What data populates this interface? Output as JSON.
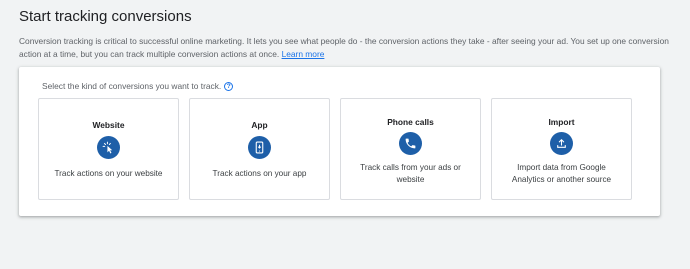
{
  "header": {
    "title": "Start tracking conversions",
    "intro": "Conversion tracking is critical to successful online marketing. It lets you see what people do - the conversion actions they take - after seeing your ad. You set up one conversion action at a time, but you can track multiple conversion actions at once.",
    "learn_more": "Learn more"
  },
  "selector": {
    "prompt": "Select the kind of conversions you want to track.",
    "help_icon": "help-circle-icon",
    "cards": [
      {
        "title": "Website",
        "icon": "cursor-click-icon",
        "description": "Track actions on your website"
      },
      {
        "title": "App",
        "icon": "mobile-app-icon",
        "description": "Track actions on your app"
      },
      {
        "title": "Phone calls",
        "icon": "phone-icon",
        "description": "Track calls from your ads or website"
      },
      {
        "title": "Import",
        "icon": "upload-icon",
        "description": "Import data from Google Analytics or another source"
      }
    ]
  },
  "colors": {
    "accent": "#1a73e8",
    "icon_bg": "#1e5fa8",
    "page_bg": "#f1f3f4"
  }
}
